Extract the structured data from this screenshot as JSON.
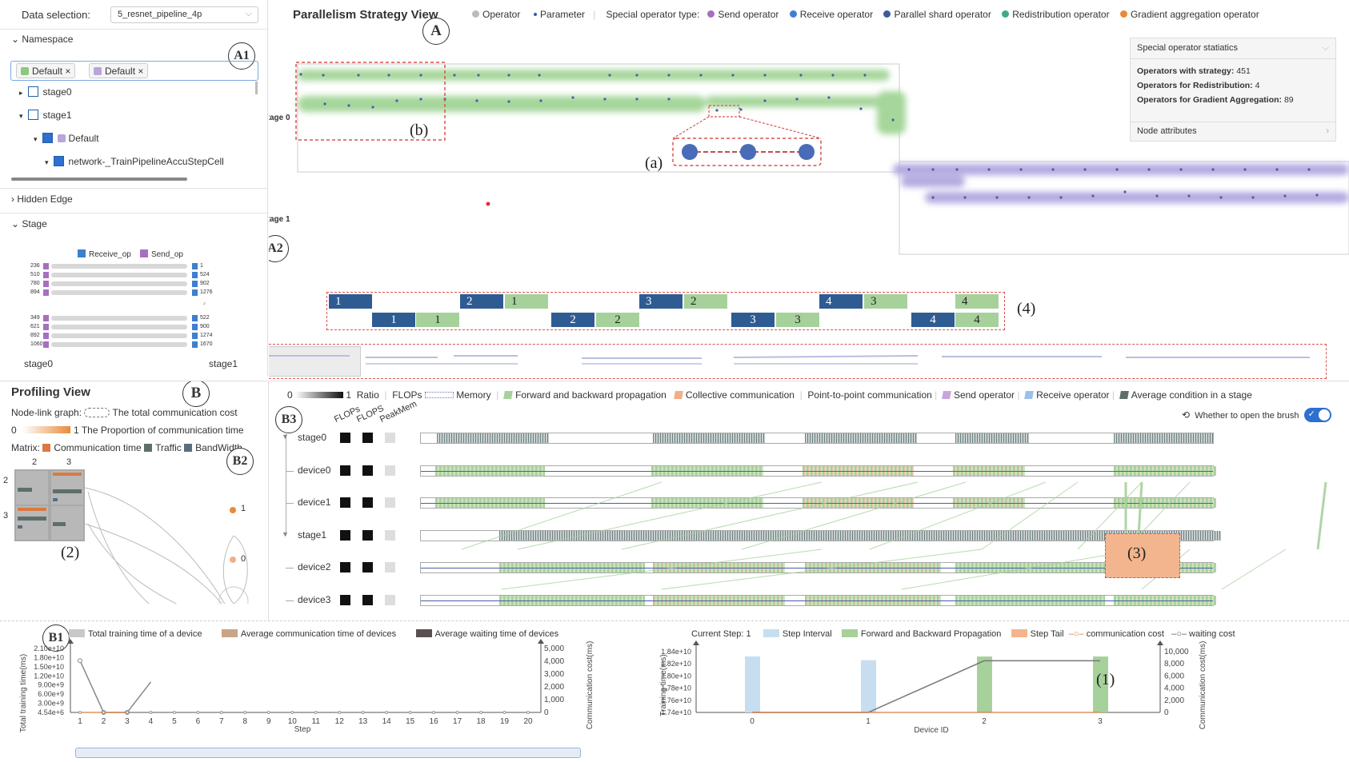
{
  "header": {
    "data_selection_label": "Data selection:",
    "data_selection_value": "5_resnet_pipeline_4p",
    "view_title": "Parallelism Strategy View",
    "legend": {
      "operator": "Operator",
      "parameter": "Parameter",
      "special_type_label": "Special operator type:",
      "send": "Send operator",
      "receive": "Receive operator",
      "parallel_shard": "Parallel shard operator",
      "redistribution": "Redistribution operator",
      "gradient_aggregation": "Gradient aggregation operator"
    },
    "colors": {
      "send": "#a66fc1",
      "receive": "#3e7fd0",
      "parallel_shard": "#3f5a98",
      "redistribution": "#3fa88c",
      "gradient_aggregation": "#e88a3a"
    }
  },
  "left_panel": {
    "namespace_title": "Namespace",
    "tags": [
      "Default",
      "Default"
    ],
    "tree": [
      {
        "label": "stage0"
      },
      {
        "label": "stage1"
      },
      {
        "label": "Default"
      },
      {
        "label": "network-_TrainPipelineAccuStepCell"
      }
    ],
    "hidden_edge_title": "Hidden Edge",
    "stage_title": "Stage",
    "stage_legend": {
      "receive": "Receive_op",
      "send": "Send_op"
    },
    "stage_rows_top": [
      {
        "left": "236",
        "right": "1"
      },
      {
        "left": "510",
        "right": "524"
      },
      {
        "left": "780",
        "right": "902"
      },
      {
        "left": "894",
        "right": "1276"
      }
    ],
    "stage_rows_bottom": [
      {
        "left": "349",
        "right": "522"
      },
      {
        "left": "621",
        "right": "900"
      },
      {
        "left": "892",
        "right": "1274"
      },
      {
        "left": "1060",
        "right": "1670"
      }
    ],
    "stage_axis": {
      "left": "stage0",
      "right": "stage1"
    }
  },
  "main_view": {
    "stage0_label": "Stage 0",
    "stage1_label": "Stage 1",
    "annotations": {
      "A": "A",
      "A1": "A1",
      "A2": "A2",
      "a": "(a)",
      "b": "(b)",
      "four": "(4)"
    },
    "stats": {
      "title": "Special operator statiatics",
      "rows": [
        {
          "label": "Operators with strategy:",
          "value": "451"
        },
        {
          "label": "Operators for Redistribution:",
          "value": "4"
        },
        {
          "label": "Operators for Gradient Aggregation:",
          "value": "89"
        }
      ],
      "node_attributes": "Node attributes"
    },
    "pipeline_row1": [
      "1",
      "2",
      "1",
      "3",
      "2",
      "4",
      "3",
      "4"
    ],
    "pipeline_row2": [
      "1",
      "1",
      "2",
      "2",
      "3",
      "3",
      "4",
      "4"
    ]
  },
  "profiling": {
    "title": "Profiling View",
    "circle_B": "B",
    "circle_B1": "B1",
    "circle_B2": "B2",
    "circle_B3": "B3",
    "node_link_label": "Node-link graph:",
    "node_link_text": "The total communication cost",
    "scale_min": "0",
    "scale_max": "1",
    "scale_text": "The Proportion of communication time",
    "matrix_label": "Matrix:",
    "matrix_items": [
      "Communication time",
      "Traffic",
      "BandWidth"
    ],
    "matrix_cols": [
      "2",
      "3"
    ],
    "matrix_rows": [
      "2",
      "3"
    ],
    "graph_nodes": [
      "1",
      "0"
    ],
    "ann_2": "(2)",
    "ann_3": "(3)",
    "legend": {
      "ratio_min": "0",
      "ratio_max": "1",
      "ratio": "Ratio",
      "flops": "FLOPs",
      "memory": "Memory",
      "fwd_bwd": "Forward and backward propagation",
      "collective": "Collective communication",
      "p2p": "Point-to-point communication",
      "send": "Send operator",
      "receive": "Receive operator",
      "avg_condition": "Average condition in a stage"
    },
    "brush_label": "Whether to open the brush",
    "brush_on": true,
    "col_headers": [
      "FLOPs",
      "FLOPS",
      "PeakMem"
    ],
    "rows": [
      {
        "label": "stage0",
        "type": "stage",
        "cells": [
          "k",
          "k",
          "g"
        ]
      },
      {
        "label": "device0",
        "type": "device",
        "cells": [
          "k",
          "k",
          "g"
        ]
      },
      {
        "label": "device1",
        "type": "device",
        "cells": [
          "k",
          "k",
          "g"
        ]
      },
      {
        "label": "stage1",
        "type": "stage",
        "cells": [
          "k",
          "k",
          "g"
        ]
      },
      {
        "label": "device2",
        "type": "device",
        "cells": [
          "k",
          "k",
          "g"
        ]
      },
      {
        "label": "device3",
        "type": "device",
        "cells": [
          "k",
          "k",
          "g"
        ]
      }
    ]
  },
  "bottom_left_chart": {
    "legend": [
      "Total training time of a device",
      "Average communication time of devices",
      "Average waiting time of devices"
    ],
    "legend_colors": [
      "#c8c8c8",
      "#c9a487",
      "#5a5050"
    ],
    "ylabel": "Total training time(ms)",
    "y2label": "Communication cost(ms)",
    "xlabel": "Step",
    "yticks": [
      "2.10e+10",
      "1.80e+10",
      "1.50e+10",
      "1.20e+10",
      "9.00e+9",
      "6.00e+9",
      "3.00e+9",
      "4.54e+6"
    ],
    "y2ticks": [
      "5,000",
      "4,000",
      "3,000",
      "2,000",
      "1,000",
      "0"
    ],
    "xticks": [
      "1",
      "2",
      "3",
      "4",
      "5",
      "6",
      "7",
      "8",
      "9",
      "10",
      "11",
      "12",
      "13",
      "14",
      "15",
      "16",
      "17",
      "18",
      "19",
      "20"
    ]
  },
  "bottom_right_chart": {
    "current_step_label": "Current Step:",
    "current_step": "1",
    "legend": [
      "Step Interval",
      "Forward and Backward Propagation",
      "Step Tail",
      "communication cost",
      "waiting cost"
    ],
    "ylabel": "Training time(ms)",
    "y2label": "Communication cost(ms)",
    "xlabel": "Device ID",
    "yticks": [
      "1.84e+10",
      "1.82e+10",
      "1.80e+10",
      "1.78e+10",
      "1.76e+10",
      "1.74e+10"
    ],
    "y2ticks": [
      "10,000",
      "8,000",
      "6,000",
      "4,000",
      "2,000",
      "0"
    ],
    "xticks": [
      "0",
      "1",
      "2",
      "3"
    ],
    "ann_1": "(1)"
  },
  "chart_data": [
    {
      "type": "line",
      "x": [
        1,
        2,
        3,
        4
      ],
      "series": [
        {
          "name": "Total training time of a device",
          "values": [
            17000000000.0,
            0,
            0,
            10000000000.0
          ]
        },
        {
          "name": "Average communication time of devices",
          "values": [
            0,
            0,
            0,
            0
          ]
        }
      ],
      "xlabel": "Step",
      "ylabel": "Total training time(ms)",
      "xlim": [
        1,
        20
      ],
      "ylim": [
        4540000.0,
        21000000000.0
      ]
    },
    {
      "type": "bar",
      "categories": [
        "0",
        "1",
        "2",
        "3"
      ],
      "series": [
        {
          "name": "Step Interval",
          "values": [
            18320000000.0,
            18260000000.0,
            0,
            0
          ]
        },
        {
          "name": "Forward and Backward Propagation",
          "values": [
            0,
            0,
            18320000000.0,
            18320000000.0
          ]
        },
        {
          "name": "waiting cost",
          "values": [
            0,
            0,
            8500,
            8500
          ]
        },
        {
          "name": "communication cost",
          "values": [
            0,
            0,
            0,
            0
          ]
        }
      ],
      "xlabel": "Device ID",
      "ylabel": "Training time(ms)",
      "ylim": [
        17400000000.0,
        18400000000.0
      ]
    }
  ]
}
